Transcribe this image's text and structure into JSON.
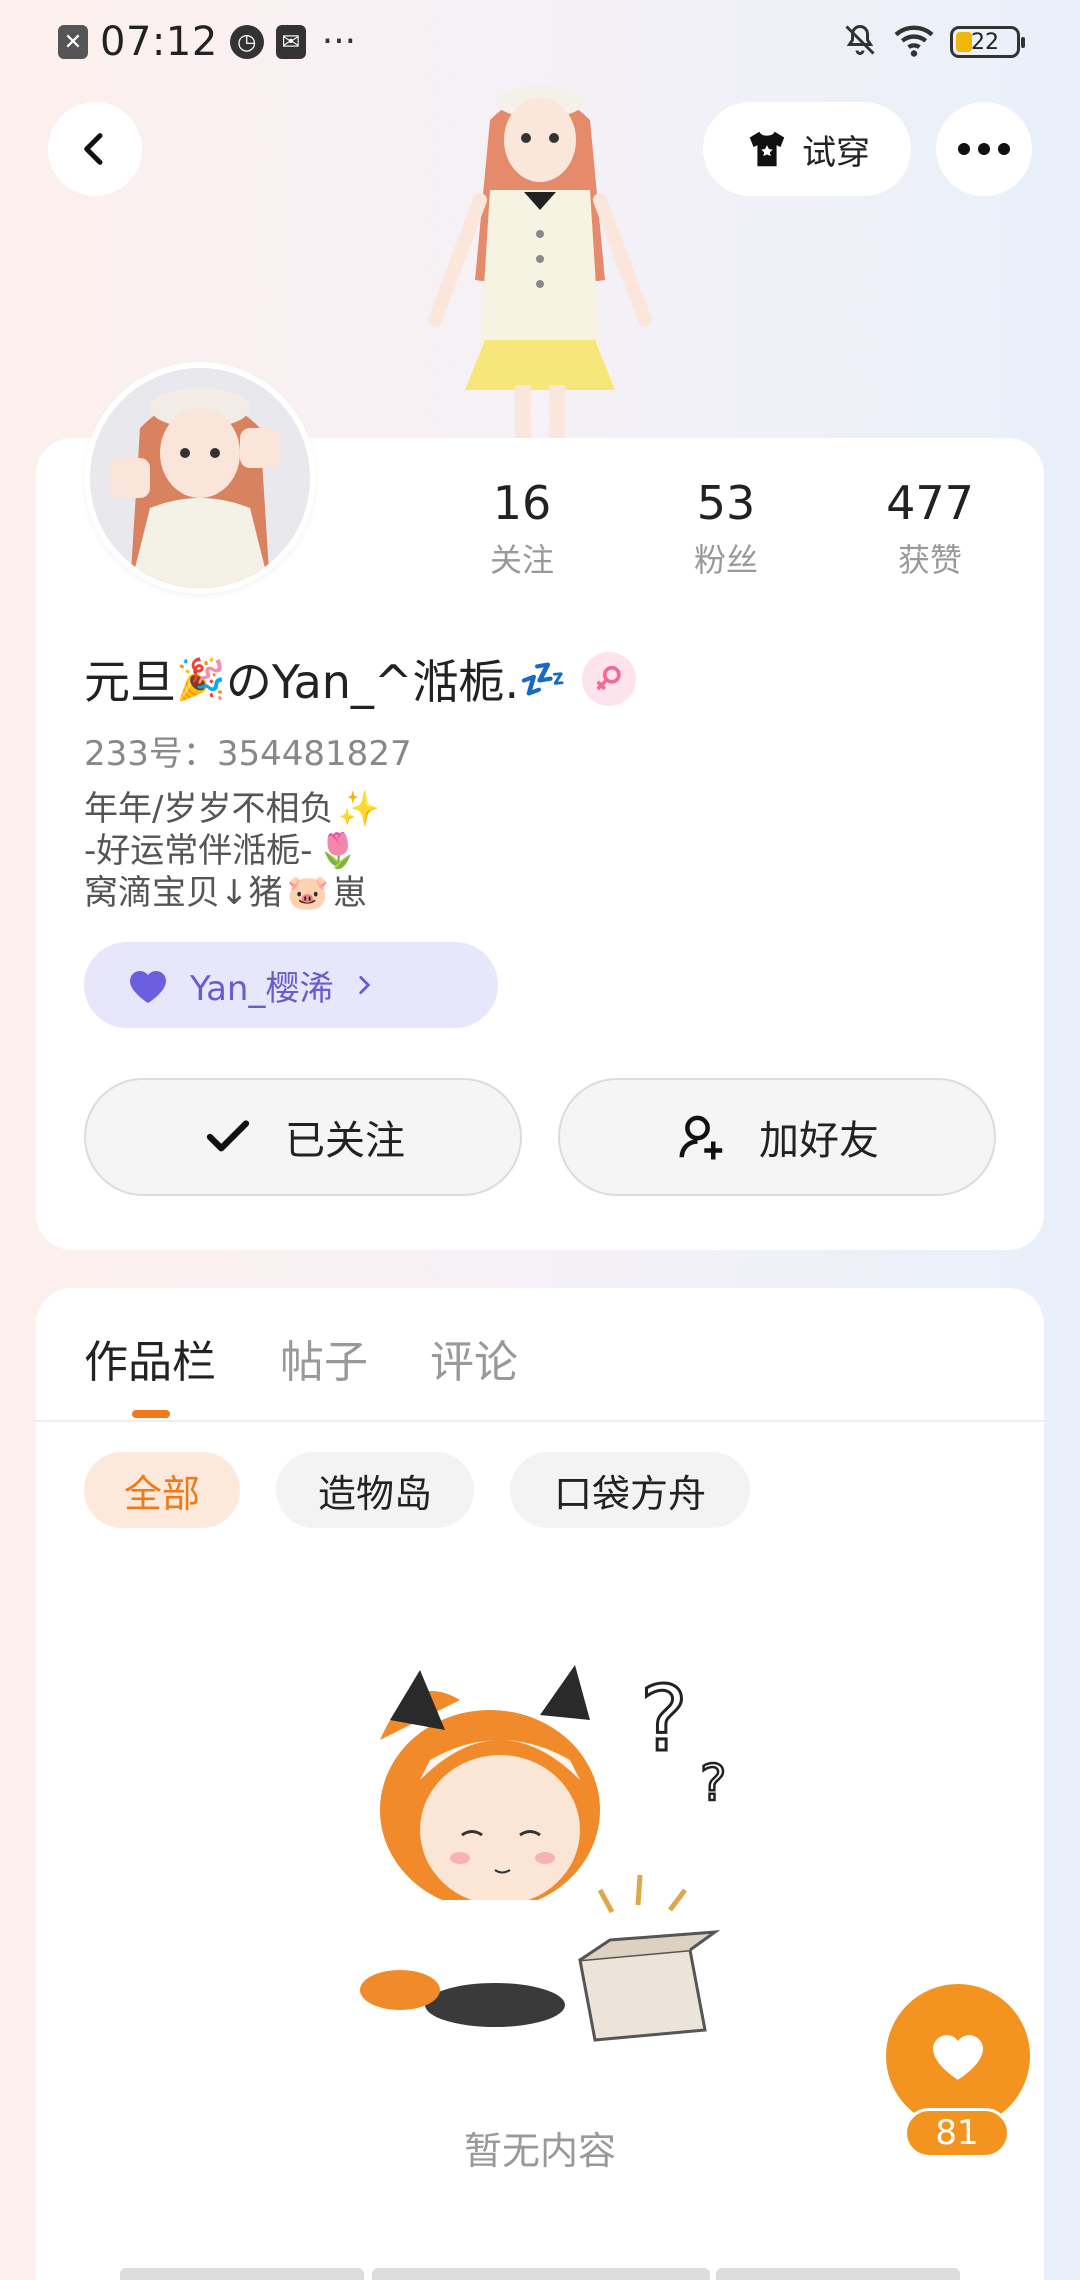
{
  "status_bar": {
    "time": "07:12",
    "more": "···",
    "battery": "22",
    "icons": [
      "close-notification-icon",
      "speed-icon",
      "mail-icon",
      "mute-icon",
      "wifi-icon",
      "battery-icon"
    ]
  },
  "header": {
    "try_on_label": "试穿"
  },
  "stats": [
    {
      "value": "16",
      "label": "关注"
    },
    {
      "value": "53",
      "label": "粉丝"
    },
    {
      "value": "477",
      "label": "获赞"
    }
  ],
  "profile": {
    "name_part1": "元旦",
    "name_part2": "のYan_^湉栀.",
    "uid": "233号：354481827",
    "bio_line1": "年年/岁岁不相负",
    "bio_line2": "-好运常伴湉栀-",
    "bio_line3a": "窝滴宝贝↓猪",
    "bio_line3b": "崽",
    "group_tag": "Yan_樱浠"
  },
  "actions": {
    "followed_label": "已关注",
    "add_friend_label": "加好友"
  },
  "tabs": [
    {
      "label": "作品栏"
    },
    {
      "label": "帖子"
    },
    {
      "label": "评论"
    }
  ],
  "chips": [
    {
      "label": "全部"
    },
    {
      "label": "造物岛"
    },
    {
      "label": "口袋方舟"
    }
  ],
  "empty_state": "暂无内容",
  "likes": "81",
  "colors": {
    "accent": "#f07a18",
    "like": "#f39420",
    "group_tag_bg": "#e8e6fb",
    "group_tag_text": "#6a5ccc"
  }
}
